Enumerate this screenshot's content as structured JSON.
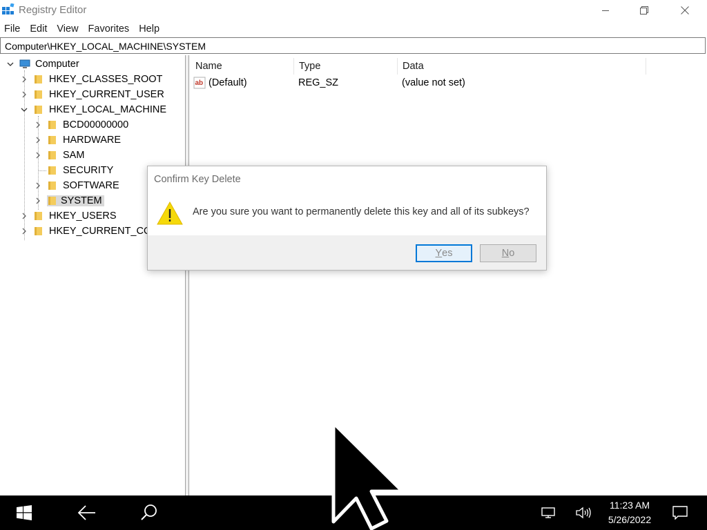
{
  "window": {
    "title": "Registry Editor"
  },
  "menu": [
    "File",
    "Edit",
    "View",
    "Favorites",
    "Help"
  ],
  "address": "Computer\\HKEY_LOCAL_MACHINE\\SYSTEM",
  "tree": {
    "root": "Computer",
    "hives": [
      "HKEY_CLASSES_ROOT",
      "HKEY_CURRENT_USER",
      "HKEY_LOCAL_MACHINE",
      "HKEY_USERS",
      "HKEY_CURRENT_CONFIG"
    ],
    "hklm_children": [
      "BCD00000000",
      "HARDWARE",
      "SAM",
      "SECURITY",
      "SOFTWARE",
      "SYSTEM"
    ],
    "selected": "SYSTEM"
  },
  "list": {
    "columns": [
      "Name",
      "Type",
      "Data"
    ],
    "rows": [
      {
        "name": "(Default)",
        "type": "REG_SZ",
        "data": "(value not set)"
      }
    ]
  },
  "dialog": {
    "title": "Confirm Key Delete",
    "message": "Are you sure you want to permanently delete this key and all of its subkeys?",
    "yes_label_first": "Y",
    "yes_label_rest": "es",
    "no_label_first": "N",
    "no_label_rest": "o"
  },
  "taskbar": {
    "time": "11:23 AM",
    "date": "5/26/2022"
  },
  "colors": {
    "accent": "#0078d7",
    "folder": "#f4cc5c",
    "taskbar": "#000000"
  }
}
